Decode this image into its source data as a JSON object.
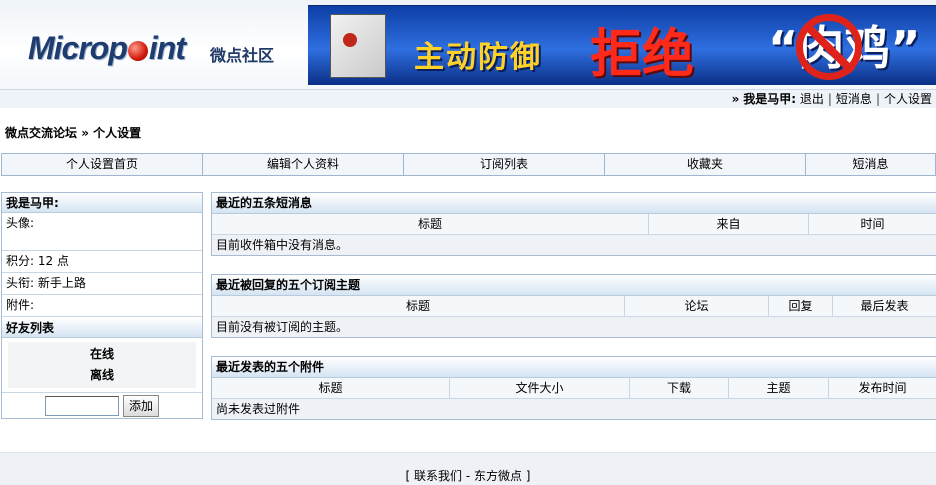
{
  "header": {
    "logo_text": "Micropoint",
    "logo_sub": "微点社区",
    "banner": {
      "text_main": "主动防御",
      "text_highlight": "拒绝",
      "text_end": "“肉鸡”"
    }
  },
  "userbar": {
    "prefix": "»",
    "user_label": "我是马甲:",
    "links": [
      "退出",
      "短消息",
      "个人设置"
    ],
    "separator": "|"
  },
  "breadcrumb": {
    "forum": "微点交流论坛",
    "arrow": "»",
    "current": "个人设置"
  },
  "tabs": [
    "个人设置首页",
    "编辑个人资料",
    "订阅列表",
    "收藏夹",
    "短消息"
  ],
  "profile": {
    "title": "我是马甲:",
    "avatar_label": "头像:",
    "points": "积分: 12 点",
    "rank": "头衔: 新手上路",
    "attachments": "附件:"
  },
  "friends": {
    "title": "好友列表",
    "online": "在线",
    "offline": "离线",
    "input_value": "",
    "add_button": "添加"
  },
  "sections": [
    {
      "title": "最近的五条短消息",
      "columns": [
        "标题",
        "来自",
        "时间"
      ],
      "empty": "目前收件箱中没有消息。"
    },
    {
      "title": "最近被回复的五个订阅主题",
      "columns": [
        "标题",
        "论坛",
        "回复",
        "最后发表"
      ],
      "empty": "目前没有被订阅的主题。"
    },
    {
      "title": "最近发表的五个附件",
      "columns": [
        "标题",
        "文件大小",
        "下载",
        "主题",
        "发布时间"
      ],
      "empty": "尚未发表过附件"
    }
  ],
  "footer": {
    "text": "[ 联系我们 - 东方微点 ]"
  }
}
